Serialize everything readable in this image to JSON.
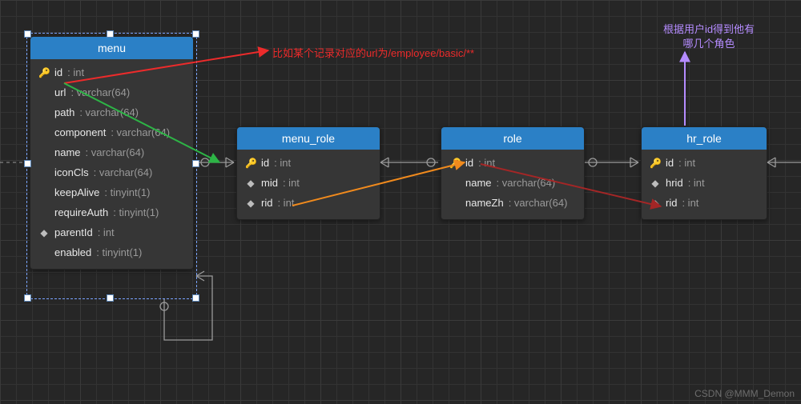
{
  "annotations": {
    "red_text": "比如某个记录对应的url为/employee/basic/**",
    "purple_line1": "根据用户id得到他有",
    "purple_line2": "哪几个角色"
  },
  "watermark": "CSDN @MMM_Demon",
  "tables": {
    "menu": {
      "title": "menu",
      "fields": [
        {
          "name": "id",
          "type": "int",
          "icon": "pk"
        },
        {
          "name": "url",
          "type": "varchar(64)",
          "icon": ""
        },
        {
          "name": "path",
          "type": "varchar(64)",
          "icon": ""
        },
        {
          "name": "component",
          "type": "varchar(64)",
          "icon": ""
        },
        {
          "name": "name",
          "type": "varchar(64)",
          "icon": ""
        },
        {
          "name": "iconCls",
          "type": "varchar(64)",
          "icon": ""
        },
        {
          "name": "keepAlive",
          "type": "tinyint(1)",
          "icon": ""
        },
        {
          "name": "requireAuth",
          "type": "tinyint(1)",
          "icon": ""
        },
        {
          "name": "parentId",
          "type": "int",
          "icon": "fk"
        },
        {
          "name": "enabled",
          "type": "tinyint(1)",
          "icon": ""
        }
      ]
    },
    "menu_role": {
      "title": "menu_role",
      "fields": [
        {
          "name": "id",
          "type": "int",
          "icon": "pk"
        },
        {
          "name": "mid",
          "type": "int",
          "icon": "fk"
        },
        {
          "name": "rid",
          "type": "int",
          "icon": "fk"
        }
      ]
    },
    "role": {
      "title": "role",
      "fields": [
        {
          "name": "id",
          "type": "int",
          "icon": "pk"
        },
        {
          "name": "name",
          "type": "varchar(64)",
          "icon": ""
        },
        {
          "name": "nameZh",
          "type": "varchar(64)",
          "icon": ""
        }
      ]
    },
    "hr_role": {
      "title": "hr_role",
      "fields": [
        {
          "name": "id",
          "type": "int",
          "icon": "pk"
        },
        {
          "name": "hrid",
          "type": "int",
          "icon": "fk"
        },
        {
          "name": "rid",
          "type": "int",
          "icon": "fk"
        }
      ]
    }
  }
}
